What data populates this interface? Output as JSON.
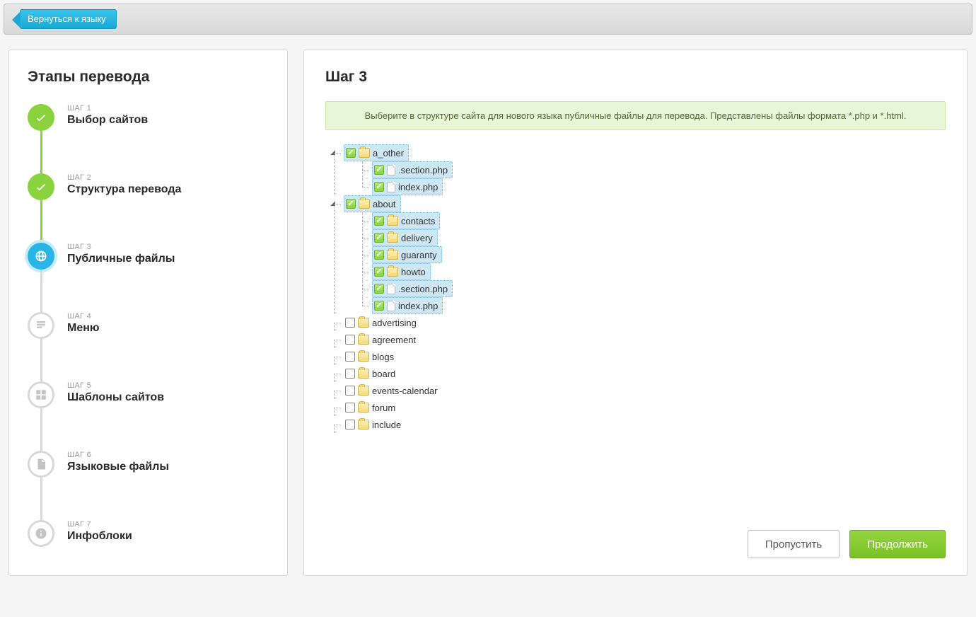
{
  "topbar": {
    "back_label": "Вернуться к языку"
  },
  "sidebar": {
    "title": "Этапы перевода",
    "steps": [
      {
        "label": "ШАГ 1",
        "title": "Выбор сайтов",
        "state": "done",
        "icon": "check"
      },
      {
        "label": "ШАГ 2",
        "title": "Структура перевода",
        "state": "done",
        "icon": "check"
      },
      {
        "label": "ШАГ 3",
        "title": "Публичные файлы",
        "state": "active",
        "icon": "world"
      },
      {
        "label": "ШАГ 4",
        "title": "Меню",
        "state": "future",
        "icon": "doc"
      },
      {
        "label": "ШАГ 5",
        "title": "Шаблоны сайтов",
        "state": "future",
        "icon": "grid"
      },
      {
        "label": "ШАГ 6",
        "title": "Языковые файлы",
        "state": "future",
        "icon": "file"
      },
      {
        "label": "ШАГ 7",
        "title": "Инфоблоки",
        "state": "future",
        "icon": "info"
      }
    ]
  },
  "main": {
    "title": "Шаг 3",
    "notice": "Выберите в структуре сайта для нового языка публичные файлы для перевода. Представлены файлы формата *.php и *.html.",
    "skip_label": "Пропустить",
    "continue_label": "Продолжить"
  },
  "tree": [
    {
      "name": "a_other",
      "type": "folder",
      "checked": true,
      "selected": true,
      "expanded": true,
      "children": [
        {
          "name": ".section.php",
          "type": "file",
          "checked": true,
          "selected": true
        },
        {
          "name": "index.php",
          "type": "file",
          "checked": true,
          "selected": true
        }
      ]
    },
    {
      "name": "about",
      "type": "folder",
      "checked": true,
      "selected": true,
      "expanded": true,
      "children": [
        {
          "name": "contacts",
          "type": "folder",
          "checked": true,
          "selected": true
        },
        {
          "name": "delivery",
          "type": "folder",
          "checked": true,
          "selected": true
        },
        {
          "name": "guaranty",
          "type": "folder",
          "checked": true,
          "selected": true
        },
        {
          "name": "howto",
          "type": "folder",
          "checked": true,
          "selected": true
        },
        {
          "name": ".section.php",
          "type": "file",
          "checked": true,
          "selected": true
        },
        {
          "name": "index.php",
          "type": "file",
          "checked": true,
          "selected": true
        }
      ]
    },
    {
      "name": "advertising",
      "type": "folder",
      "checked": false,
      "selected": false
    },
    {
      "name": "agreement",
      "type": "folder",
      "checked": false,
      "selected": false
    },
    {
      "name": "blogs",
      "type": "folder",
      "checked": false,
      "selected": false
    },
    {
      "name": "board",
      "type": "folder",
      "checked": false,
      "selected": false
    },
    {
      "name": "events-calendar",
      "type": "folder",
      "checked": false,
      "selected": false
    },
    {
      "name": "forum",
      "type": "folder",
      "checked": false,
      "selected": false
    },
    {
      "name": "include",
      "type": "folder",
      "checked": false,
      "selected": false
    }
  ]
}
